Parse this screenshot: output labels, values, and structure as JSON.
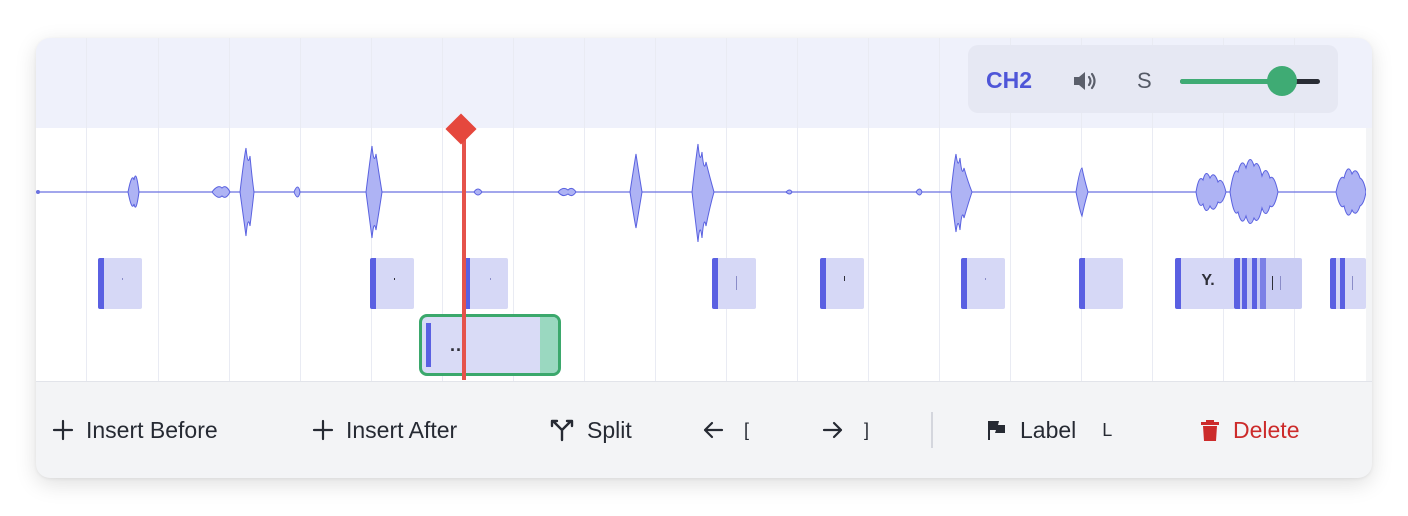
{
  "channel": {
    "name": "CH2",
    "speaker_icon": "speaker-icon",
    "solo_label": "S",
    "volume": 0.73,
    "accent_color": "#4f56d8",
    "volume_color": "#3fab74"
  },
  "segments": {
    "row1": [
      {
        "text": ""
      },
      {
        "text": ""
      },
      {
        "text": ""
      },
      {
        "text": ""
      },
      {
        "text": ""
      },
      {
        "text": ""
      },
      {
        "text": ""
      },
      {
        "text": "Y."
      },
      {
        "text": ""
      },
      {
        "text": ""
      }
    ],
    "selected": {
      "text": "..."
    }
  },
  "playhead": {
    "color": "#e5473d"
  },
  "toolbar": {
    "insert_before": "Insert Before",
    "insert_after": "Insert After",
    "split": "Split",
    "prev_key": "[",
    "next_key": "]",
    "label": "Label",
    "label_key": "L",
    "delete": "Delete",
    "delete_color": "#cc2b2b"
  }
}
